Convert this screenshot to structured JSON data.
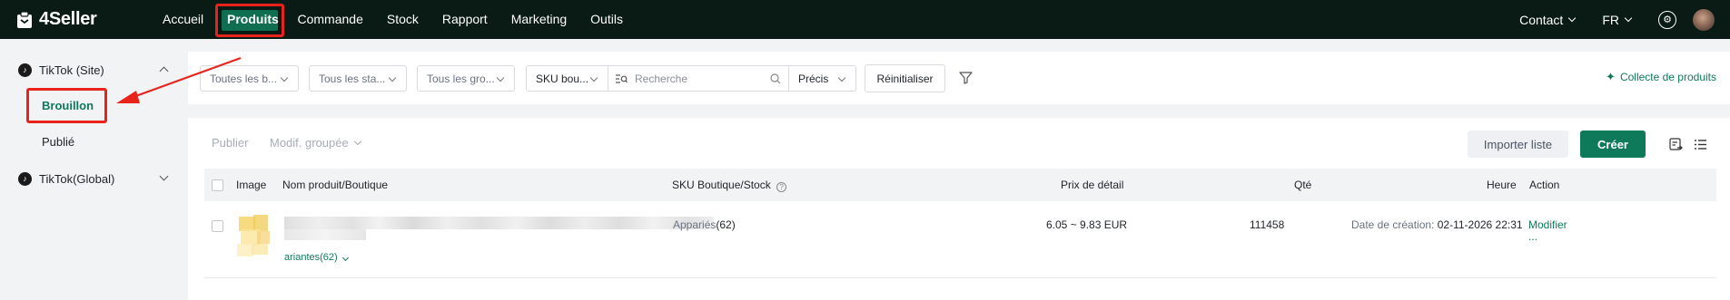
{
  "app": {
    "name": "4Seller"
  },
  "topnav": {
    "items": [
      "Accueil",
      "Produits",
      "Commande",
      "Stock",
      "Rapport",
      "Marketing",
      "Outils"
    ],
    "active": "Produits"
  },
  "right_nav": {
    "contact": "Contact",
    "lang": "FR"
  },
  "sidebar": {
    "group1": "TikTok (Site)",
    "items": [
      "Brouillon",
      "Publié"
    ],
    "active_item": "Brouillon",
    "group2": "TikTok(Global)"
  },
  "filters": {
    "stores": "Toutes les b...",
    "statuses": "Tous les sta...",
    "groups": "Tous les gro...",
    "search_field": "SKU bou...",
    "search_placeholder": "Recherche",
    "match": "Précis",
    "reset": "Réinitialiser",
    "collect": "Collecte de produits"
  },
  "toolbar": {
    "publish": "Publier",
    "bulk_edit": "Modif. groupée",
    "import": "Importer liste",
    "create": "Créer"
  },
  "table": {
    "headers": {
      "image": "Image",
      "name": "Nom produit/Boutique",
      "sku": "SKU Boutique/Stock",
      "price": "Prix de détail",
      "qty": "Qté",
      "time": "Heure",
      "action": "Action"
    },
    "rows": [
      {
        "variants": "ariantes(62)",
        "sku_status": "Appariés",
        "sku_count": "(62)",
        "price": "6.05 ~ 9.83 EUR",
        "qty": "111458",
        "created_label": "Date de création:",
        "created_value": "02-11-2026 22:31",
        "action": "Modifier",
        "more": "..."
      }
    ]
  },
  "colors": {
    "topbar": "#0a1a14",
    "brand_green": "#0f7a5a",
    "annotation_red": "#e8231c"
  }
}
